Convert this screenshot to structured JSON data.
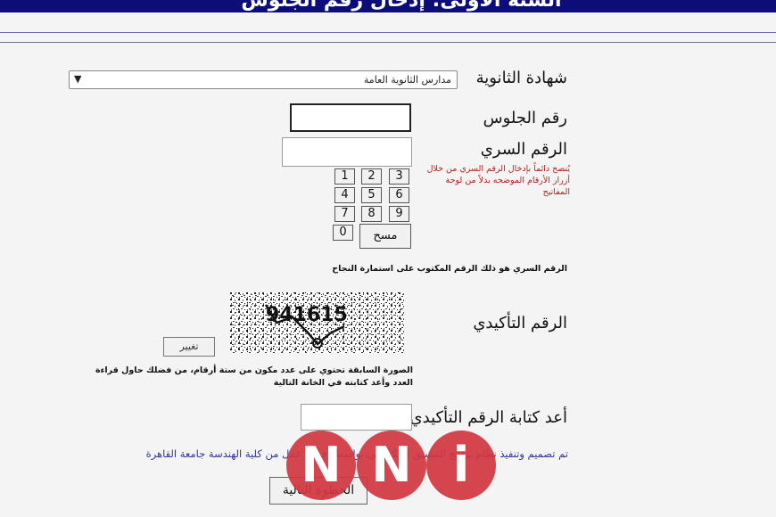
{
  "header": {
    "title": "السنة الأولى: إدخال رقم الجلوس"
  },
  "form": {
    "certificate_label": "شهادة الثانوية",
    "certificate_selected": "مدارس الثانوية العامة",
    "seat_label": "رقم الجلوس",
    "seat_value": "",
    "secret_label": "الرقم السري",
    "secret_value": "",
    "keypad_keys": [
      "1",
      "2",
      "3",
      "4",
      "5",
      "6",
      "7",
      "8",
      "9",
      "0"
    ],
    "keypad_clear": "مسح",
    "secret_hint_red": "يُنصح دائماً بإدخال الرقم السري من خلال أزرار الأرقام الموضحه بدلاً من لوحة المفاتيح",
    "secret_hint_bold": "الرقم السري هو ذلك الرقم المكتوب على استمارة النجاح",
    "captcha_label": "الرقم التأكيدي",
    "captcha_text": "941615",
    "change_button": "تغيير",
    "captcha_hint": "الصورة السابقة تحتوي على عدد مكون من ستة أرقام، من فضلك حاول قراءة العدد وأعد كتابته في الخانة التالية",
    "confirm_label": "أعد كتابة الرقم التأكيدي",
    "confirm_value": ""
  },
  "footer": {
    "credit": "تم تصميم وتنفيذ نظام برامج التنسيق الإلكتروني بواسطة فريق عمل من كلية الهندسة جامعة القاهرة",
    "next_button": "الخطوة التالية"
  },
  "watermark": {
    "letters": [
      "N",
      "N",
      "i"
    ],
    "color": "#d1373f"
  }
}
